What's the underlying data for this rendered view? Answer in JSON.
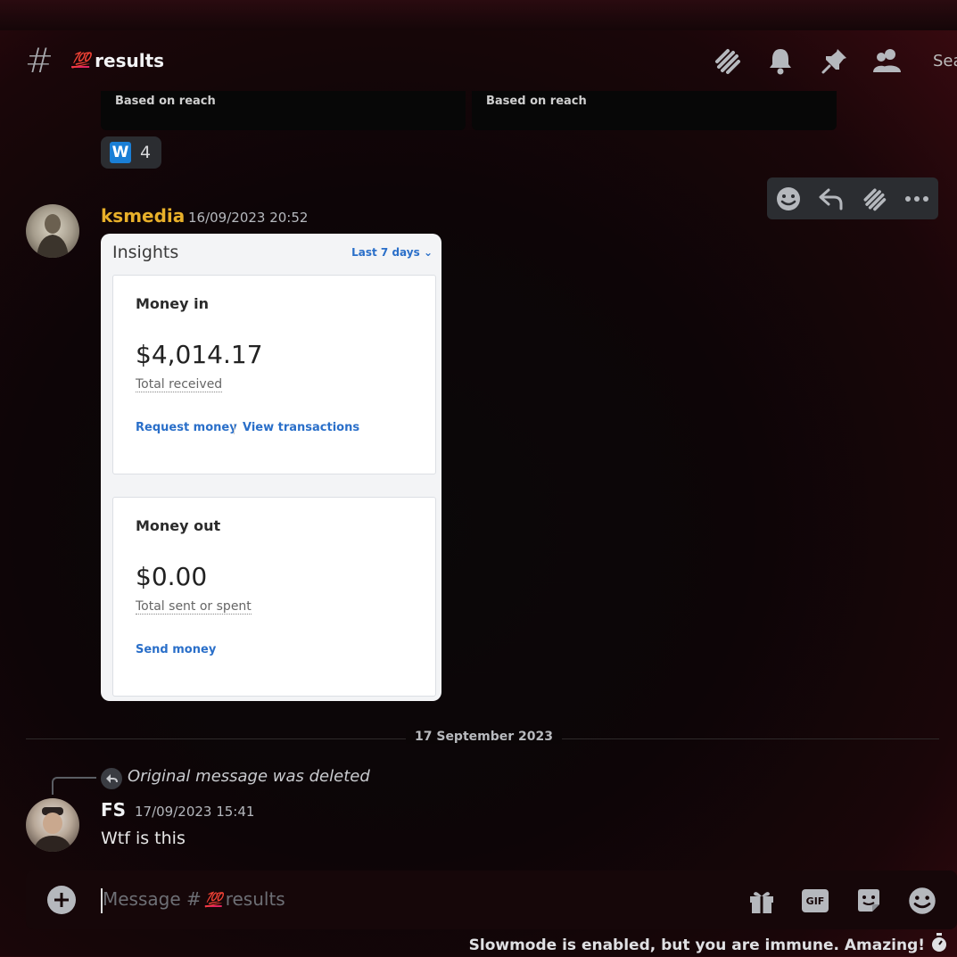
{
  "header": {
    "channel_emoji": "💯",
    "channel_name": "results",
    "search_fragment": "Sea"
  },
  "embeds": {
    "left_caption": "Based on reach",
    "right_caption": "Based on reach"
  },
  "reaction": {
    "emoji_letter": "W",
    "count": "4"
  },
  "message1": {
    "author": "ksmedia",
    "timestamp": "16/09/2023 20:52",
    "author_color": "#e8b02a"
  },
  "insights": {
    "title": "Insights",
    "range": "Last 7 days",
    "money_in": {
      "heading": "Money in",
      "amount": "$4,014.17",
      "subtitle": "Total received",
      "link1": "Request money",
      "link2": "View transactions"
    },
    "money_out": {
      "heading": "Money out",
      "amount": "$0.00",
      "subtitle": "Total sent or spent",
      "link1": "Send money"
    }
  },
  "divider": {
    "date": "17 September 2023"
  },
  "message2": {
    "reply_text": "Original message was deleted",
    "author": "FS",
    "timestamp": "17/09/2023 15:41",
    "content": "Wtf is this"
  },
  "composer": {
    "placeholder_prefix": "Message #",
    "placeholder_emoji": "💯",
    "placeholder_channel": "results"
  },
  "footer": {
    "slowmode": "Slowmode is enabled, but you are immune. Amazing!"
  },
  "colors": {
    "accent_blue": "#2a6fc9",
    "hundred_red": "#e0245e"
  }
}
